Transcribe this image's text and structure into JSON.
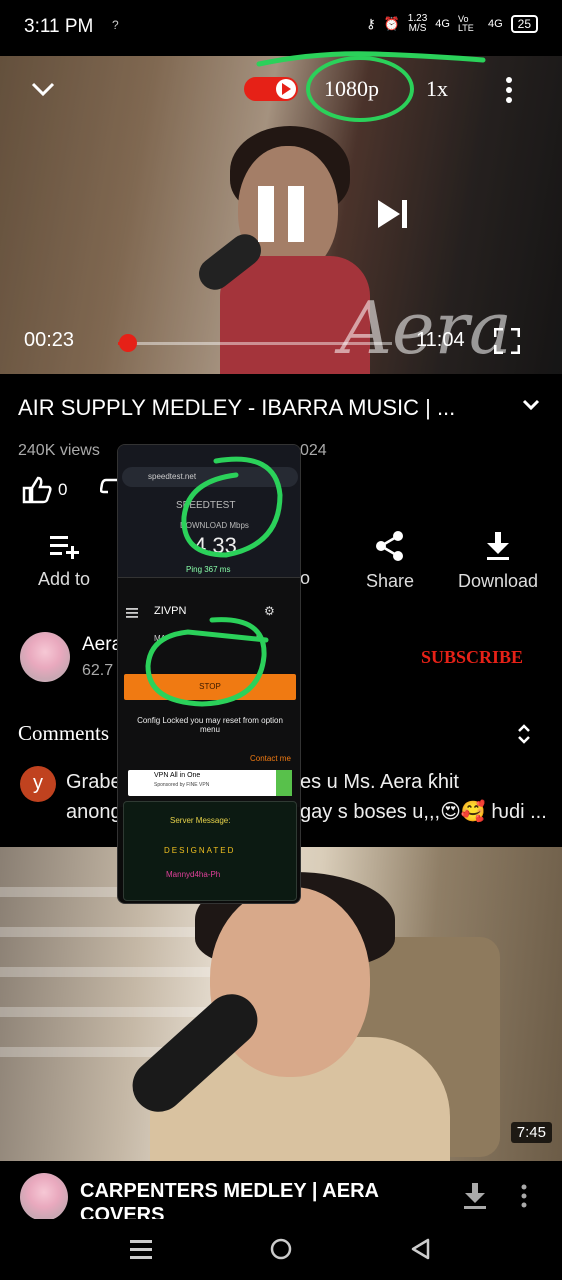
{
  "status_bar": {
    "time": "3:11 PM",
    "signal_small": "?",
    "net_speed_top": "1.23",
    "net_speed_unit": "M/S",
    "net1": "4G",
    "volte": "Vo LTE",
    "net2": "4G",
    "battery": "25"
  },
  "player": {
    "quality": "1080p",
    "speed": "1x",
    "elapsed": "00:23",
    "duration": "11:04",
    "progress_fraction": 0.035,
    "watermark": "Aera"
  },
  "video": {
    "title": "AIR SUPPLY MEDLEY - IBARRA MUSIC | ...",
    "views": "240K views",
    "date_partial": "024",
    "likes": "0"
  },
  "actions": {
    "add_to": "Add to",
    "partial": "o",
    "share": "Share",
    "download": "Download"
  },
  "channel": {
    "name_partial": "Aera",
    "subs_partial": "62.7",
    "subscribe": "SUBSCRIBE"
  },
  "comments": {
    "header": "Comments",
    "avatar_letter": "y",
    "line1_a": "Grabe",
    "line1_b": "es u Ms. Aera ƙhit",
    "line2_a": "anong",
    "line2_b": "gay s boses u,,,😍🥰 ƕdi ..."
  },
  "next_video": {
    "duration": "7:45",
    "title": "CARPENTERS MEDLEY | AERA COVERS"
  },
  "overlay": {
    "url": "speedtest.net",
    "speedtest_brand": "SPEEDTEST",
    "download_label": "DOWNLOAD Mbps",
    "download_value": "4.33",
    "ping": "Ping 367 ms",
    "app_name": "ZIVPN",
    "mode_partial": "MA",
    "mode_partial2": "H",
    "stop_button": "STOP",
    "config_text": "Config Locked you may reset from option menu",
    "contact": "Contact me",
    "ad_title": "VPN All in One",
    "ad_sub": "Sponsored by FINE VPN",
    "server_message_label": "Server Message:",
    "designated": "DESIGNATED",
    "signature": "Mannyd4ha-Ph"
  },
  "colors": {
    "accent_red": "#e62117",
    "annotation_green": "#2bd15a",
    "zivpn_orange": "#f07a12"
  }
}
